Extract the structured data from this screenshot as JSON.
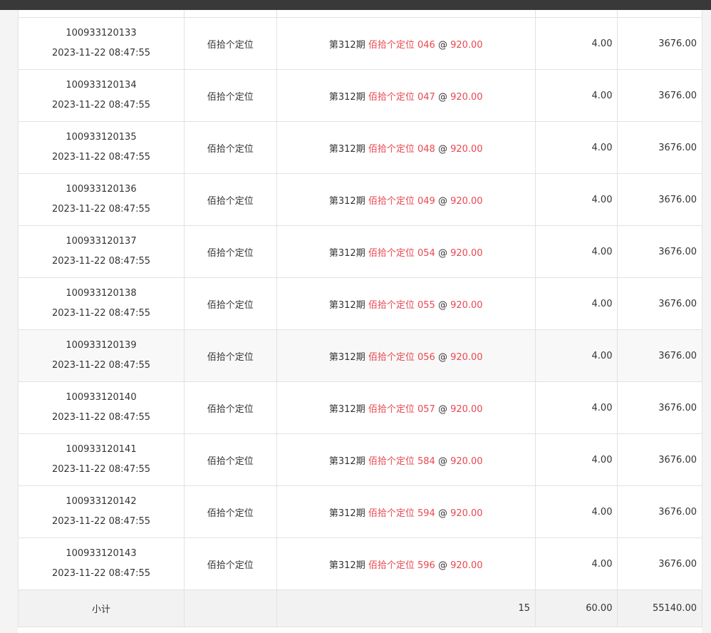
{
  "rows": [
    {
      "order_no": "100933120133",
      "time": "2023-11-22 08:47:55",
      "type": "佰拾个定位",
      "period": "第312期",
      "bet": "佰拾个定位 046",
      "at": "@",
      "odds": "920.00",
      "amount": "4.00",
      "prize": "3676.00"
    },
    {
      "order_no": "100933120134",
      "time": "2023-11-22 08:47:55",
      "type": "佰拾个定位",
      "period": "第312期",
      "bet": "佰拾个定位 047",
      "at": "@",
      "odds": "920.00",
      "amount": "4.00",
      "prize": "3676.00"
    },
    {
      "order_no": "100933120135",
      "time": "2023-11-22 08:47:55",
      "type": "佰拾个定位",
      "period": "第312期",
      "bet": "佰拾个定位 048",
      "at": "@",
      "odds": "920.00",
      "amount": "4.00",
      "prize": "3676.00"
    },
    {
      "order_no": "100933120136",
      "time": "2023-11-22 08:47:55",
      "type": "佰拾个定位",
      "period": "第312期",
      "bet": "佰拾个定位 049",
      "at": "@",
      "odds": "920.00",
      "amount": "4.00",
      "prize": "3676.00"
    },
    {
      "order_no": "100933120137",
      "time": "2023-11-22 08:47:55",
      "type": "佰拾个定位",
      "period": "第312期",
      "bet": "佰拾个定位 054",
      "at": "@",
      "odds": "920.00",
      "amount": "4.00",
      "prize": "3676.00"
    },
    {
      "order_no": "100933120138",
      "time": "2023-11-22 08:47:55",
      "type": "佰拾个定位",
      "period": "第312期",
      "bet": "佰拾个定位 055",
      "at": "@",
      "odds": "920.00",
      "amount": "4.00",
      "prize": "3676.00"
    },
    {
      "order_no": "100933120139",
      "time": "2023-11-22 08:47:55",
      "type": "佰拾个定位",
      "period": "第312期",
      "bet": "佰拾个定位 056",
      "at": "@",
      "odds": "920.00",
      "amount": "4.00",
      "prize": "3676.00"
    },
    {
      "order_no": "100933120140",
      "time": "2023-11-22 08:47:55",
      "type": "佰拾个定位",
      "period": "第312期",
      "bet": "佰拾个定位 057",
      "at": "@",
      "odds": "920.00",
      "amount": "4.00",
      "prize": "3676.00"
    },
    {
      "order_no": "100933120141",
      "time": "2023-11-22 08:47:55",
      "type": "佰拾个定位",
      "period": "第312期",
      "bet": "佰拾个定位 584",
      "at": "@",
      "odds": "920.00",
      "amount": "4.00",
      "prize": "3676.00"
    },
    {
      "order_no": "100933120142",
      "time": "2023-11-22 08:47:55",
      "type": "佰拾个定位",
      "period": "第312期",
      "bet": "佰拾个定位 594",
      "at": "@",
      "odds": "920.00",
      "amount": "4.00",
      "prize": "3676.00"
    },
    {
      "order_no": "100933120143",
      "time": "2023-11-22 08:47:55",
      "type": "佰拾个定位",
      "period": "第312期",
      "bet": "佰拾个定位 596",
      "at": "@",
      "odds": "920.00",
      "amount": "4.00",
      "prize": "3676.00"
    }
  ],
  "subtotal": {
    "label": "小计",
    "count": "15",
    "amount": "60.00",
    "prize": "55140.00"
  },
  "colors": {
    "highlight": "#e8484f",
    "topbar": "#393939",
    "hover_row": "#f8f8f8",
    "subtotal_row": "#f2f2f2"
  }
}
